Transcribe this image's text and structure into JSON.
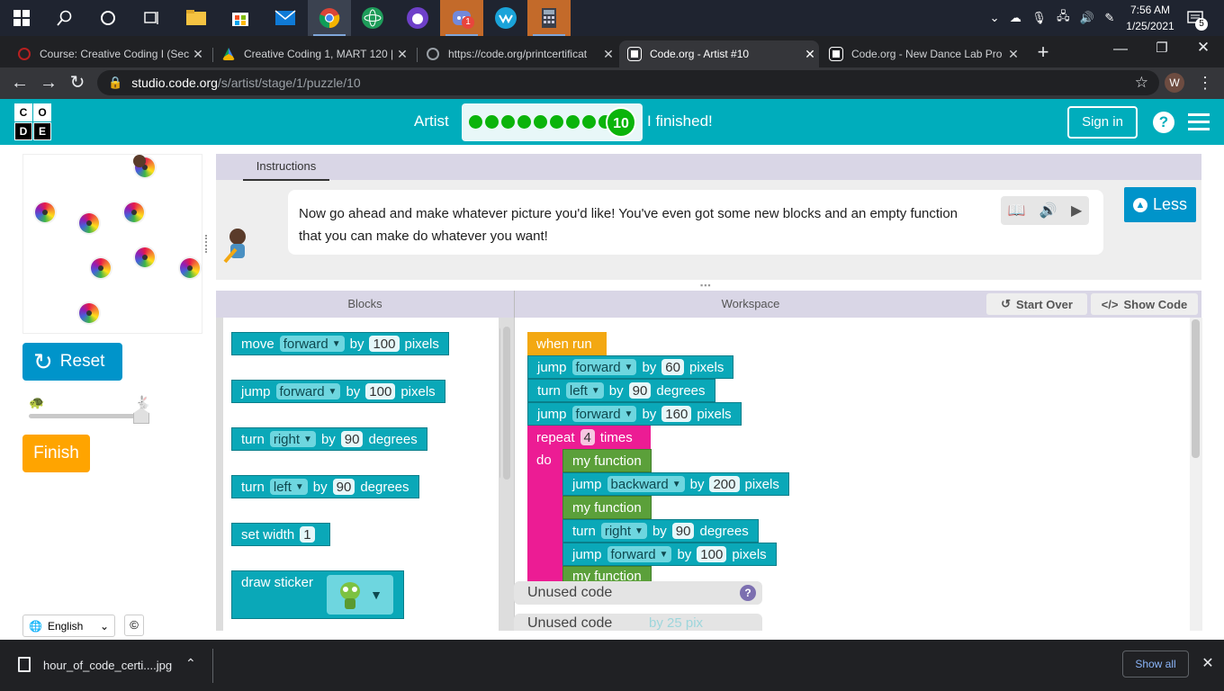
{
  "taskbar": {
    "discord_badge": "1",
    "time": "7:56 AM",
    "date": "1/25/2021",
    "notification_count": "5"
  },
  "tabs": [
    {
      "title": "Course: Creative Coding I (Sect"
    },
    {
      "title": "Creative Coding 1, MART 120 |"
    },
    {
      "title": "https://code.org/printcertificat"
    },
    {
      "title": "Code.org - Artist #10"
    },
    {
      "title": "Code.org - New Dance Lab Pro"
    }
  ],
  "browser": {
    "url_host": "studio.code.org",
    "url_path": "/s/artist/stage/1/puzzle/10",
    "profile_initial": "W",
    "new_tab": "+"
  },
  "header": {
    "logo_letters": [
      "C",
      "O",
      "D",
      "E"
    ],
    "level_name": "Artist",
    "current_level": "10",
    "finished_text": "I finished!",
    "sign_in": "Sign in",
    "help": "?"
  },
  "left": {
    "reset": "Reset",
    "finish": "Finish",
    "language": "English",
    "copyright": "©"
  },
  "instructions": {
    "tab": "Instructions",
    "text": "Now go ahead and make whatever picture you'd like! You've even got some new blocks and an empty function that you can make do whatever you want!",
    "less_button": "Less"
  },
  "toolbox": {
    "title": "Blocks",
    "blocks": [
      {
        "a": "move",
        "b": "forward",
        "c": "by",
        "d": "100",
        "e": "pixels"
      },
      {
        "a": "jump",
        "b": "forward",
        "c": "by",
        "d": "100",
        "e": "pixels"
      },
      {
        "a": "turn",
        "b": "right",
        "c": "by",
        "d": "90",
        "e": "degrees"
      },
      {
        "a": "turn",
        "b": "left",
        "c": "by",
        "d": "90",
        "e": "degrees"
      },
      {
        "a": "set width",
        "d": "1"
      },
      {
        "a": "draw sticker"
      }
    ]
  },
  "workspace": {
    "title": "Workspace",
    "start_over": "Start Over",
    "show_code": "Show Code",
    "when_run": "when run",
    "line1": {
      "a": "jump",
      "b": "forward",
      "c": "by",
      "d": "60",
      "e": "pixels"
    },
    "line2": {
      "a": "turn",
      "b": "left",
      "c": "by",
      "d": "90",
      "e": "degrees"
    },
    "line3": {
      "a": "jump",
      "b": "forward",
      "c": "by",
      "d": "160",
      "e": "pixels"
    },
    "repeat_label": "repeat",
    "repeat_count": "4",
    "repeat_times": "times",
    "do": "do",
    "func1": "my function",
    "line4": {
      "a": "jump",
      "b": "backward",
      "c": "by",
      "d": "200",
      "e": "pixels"
    },
    "func2": "my function",
    "line5": {
      "a": "turn",
      "b": "right",
      "c": "by",
      "d": "90",
      "e": "degrees"
    },
    "line6": {
      "a": "jump",
      "b": "forward",
      "c": "by",
      "d": "100",
      "e": "pixels"
    },
    "func3": "my function",
    "unused1": "Unused code",
    "unused2": "Unused code",
    "unused_ghost": "by 25 pix",
    "unused_help": "?"
  },
  "downloads": {
    "file": "hour_of_code_certi....jpg",
    "show_all": "Show all"
  }
}
